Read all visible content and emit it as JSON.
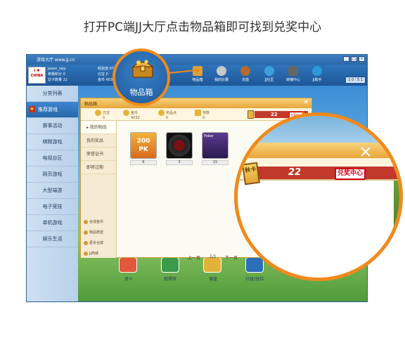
{
  "caption": "打开PC端JJ大厅点击物品箱即可找到兑奖中心",
  "window": {
    "title": "游戏大厅 www.JJ.cn",
    "flag_text": "I ♥ CHINA",
    "user": [
      "jason_zxjy",
      "参赛积分 0",
      "饮卡数量 22"
    ],
    "stats": [
      "经验值 6734",
      "元宝 0",
      "金币 4032"
    ],
    "clock": "1 0 : 5 1",
    "toolbar": [
      {
        "label": "物品箱",
        "icon": "chest-icon",
        "color": "#d9a13a"
      },
      {
        "label": "我的比赛",
        "icon": "swords-icon",
        "color": "#c8c8c8"
      },
      {
        "label": "充值",
        "icon": "bag-icon",
        "color": "#b86b2c"
      },
      {
        "label": "JJ社区",
        "icon": "globe-icon",
        "color": "#3aa0e0"
      },
      {
        "label": "转播中心",
        "icon": "camera-icon",
        "color": "#666666"
      },
      {
        "label": "JJ助手",
        "icon": "helper-icon",
        "color": "#2a9ad8"
      }
    ]
  },
  "sidebar": {
    "items": [
      "分类列表",
      "推荐游戏",
      "赛事活动",
      "棋牌游戏",
      "电视台区",
      "网页游戏",
      "大型端游",
      "电子竞技",
      "单机游戏",
      "娱乐生活"
    ]
  },
  "background_games": [
    "拼十",
    "跑得快",
    "保皇",
    "升级(拖拉"
  ],
  "dialog": {
    "title": "物品箱",
    "currencies": [
      {
        "label": "元宝",
        "value": "0"
      },
      {
        "label": "金币",
        "value": "4032"
      },
      {
        "label": "奖品点",
        "value": "0"
      },
      {
        "label": "存款",
        "value": "0"
      }
    ],
    "card_count": "22",
    "redeem_label": "兑奖中心",
    "nav": [
      "我的物品",
      "我的奖品",
      "荣誉证书",
      "即将过期"
    ],
    "actions": [
      "合成金币",
      "物品赠送",
      "更多合成",
      "JJ商城"
    ],
    "items": [
      {
        "name": "200PK 参赛券",
        "count": "6"
      },
      {
        "name": "轮胎",
        "count": "3"
      },
      {
        "name": "Poker 扑克",
        "count": "15"
      }
    ],
    "pager": {
      "prev": "上一页",
      "page": "1/1",
      "next": "下一页"
    }
  },
  "callout": {
    "label": "物品箱"
  },
  "zoom": {
    "card_label": "秋卡",
    "card_count": "22",
    "redeem_label": "兑奖中心"
  }
}
